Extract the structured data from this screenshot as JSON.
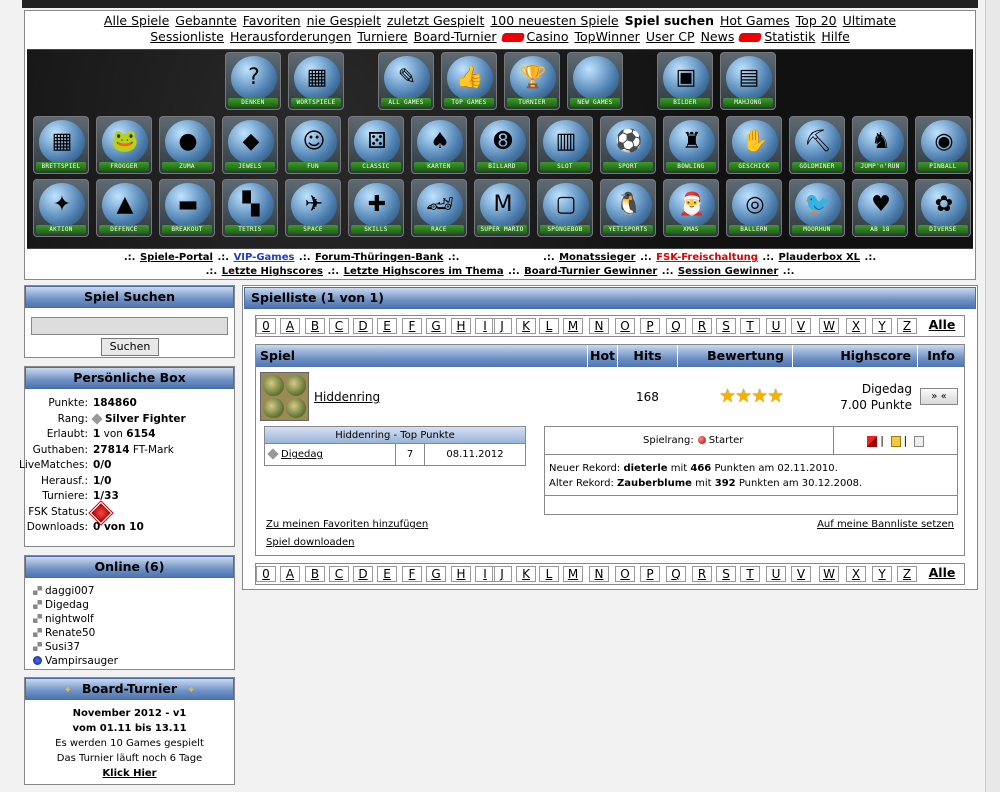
{
  "topnav": {
    "row1": [
      "Alle Spiele",
      "Gebannte",
      "Favoriten",
      "nie Gespielt",
      "zuletzt Gespielt",
      "100 neuesten Spiele",
      "Spiel suchen",
      "Hot Games",
      "Top 20",
      "Ultimate"
    ],
    "row2": [
      "Sessionliste",
      "Herausforderungen",
      "Turniere",
      "Board-Turnier",
      "Casino",
      "TopWinner",
      "User CP",
      "News",
      "Statistik",
      "Hilfe"
    ],
    "active": "Spiel suchen"
  },
  "games": {
    "row1": [
      "DENKEN",
      "WORTSPIELE",
      "ALL GAMES",
      "TOP GAMES",
      "TURNIER",
      "NEW GAMES",
      "BILDER",
      "MAHJONG"
    ],
    "row2": [
      "BRETTSPIEL",
      "FROGGER",
      "ZUMA",
      "JEWELS",
      "FUN",
      "CLASSIC",
      "KARTEN",
      "BILLARD",
      "SLOT",
      "SPORT",
      "BOWLING",
      "GESCHICK",
      "GOLDMINER",
      "JUMP'n'RUN",
      "PINBALL"
    ],
    "row3": [
      "AKTION",
      "DEFENCE",
      "BREAKOUT",
      "TETRIS",
      "SPACE",
      "SKILLS",
      "RACE",
      "SUPER MARIO",
      "SPONGEBOB",
      "YETISPORTS",
      "XMAS",
      "BALLERN",
      "MOORHUN",
      "AB 18",
      "DIVERSE"
    ]
  },
  "sublinks": {
    "spiele_portal": "Spiele-Portal",
    "vip": "VIP-Games",
    "forum": "Forum-Thüringen-Bank",
    "monatssieger": "Monatssieger",
    "fsk": "FSK-Freischaltung",
    "plauderbox": "Plauderbox XL",
    "letzte_hs": "Letzte Highscores",
    "letzte_hs_thema": "Letzte Highscores im Thema",
    "bt_gewinner": "Board-Turnier Gewinner",
    "session_gewinner": "Session Gewinner",
    "sep": ".:."
  },
  "search": {
    "title": "Spiel Suchen",
    "button": "Suchen",
    "value": ""
  },
  "profile": {
    "title": "Persönliche Box",
    "rows": [
      {
        "k": "Punkte:",
        "v": "184860"
      },
      {
        "k": "Rang:",
        "v": "Silver Fighter"
      },
      {
        "k": "Erlaubt:",
        "v": "1",
        "v2": "von",
        "v3": "6154"
      },
      {
        "k": "Guthaben:",
        "v": "27814",
        "v2": "FT-Mark"
      },
      {
        "k": "LiveMatches:",
        "v": "0/0"
      },
      {
        "k": "Herausf.:",
        "v": "1/0"
      },
      {
        "k": "Turniere:",
        "v": "1/33"
      },
      {
        "k": "FSK Status:",
        "v": ""
      },
      {
        "k": "Downloads:",
        "v": "0 von 10"
      }
    ]
  },
  "online": {
    "title": "Online (6)",
    "users": [
      "daggi007",
      "Digedag",
      "nightwolf",
      "Renate50",
      "Susi37",
      "Vampirsauger"
    ]
  },
  "board_turnier": {
    "title": "Board-Turnier",
    "line1": "November 2012 - v1",
    "line2": "vom 01.11 bis 13.11",
    "line3": "Es werden 10 Games gespielt",
    "line4": "Das Turnier läuft noch 6 Tage",
    "link": "Klick Hier"
  },
  "main": {
    "title": "Spielliste (1 von 1)",
    "letters": [
      "0",
      "A",
      "B",
      "C",
      "D",
      "E",
      "F",
      "G",
      "H",
      "I",
      "J",
      "K",
      "L",
      "M",
      "N",
      "O",
      "P",
      "Q",
      "R",
      "S",
      "T",
      "U",
      "V",
      "W",
      "X",
      "Y",
      "Z"
    ],
    "alle": "Alle",
    "columns": {
      "spiel": "Spiel",
      "hot": "Hot",
      "hits": "Hits",
      "bewertung": "Bewertung",
      "highscore": "Highscore",
      "info": "Info"
    },
    "game": {
      "name": "Hiddenring",
      "hits": "168",
      "rating": 4,
      "hs_name": "Digedag",
      "hs_points": "7.00 Punkte",
      "info_button": "» «"
    },
    "top_points": {
      "title": "Hiddenring - Top Punkte",
      "rows": [
        {
          "name": "Digedag",
          "score": "7",
          "date": "08.11.2012"
        }
      ]
    },
    "rank": {
      "label": "Spielrang:",
      "value": "Starter",
      "new_record_pre": "Neuer Rekord:",
      "new_record_name": "dieterle",
      "new_record_mid": "mit",
      "new_record_points": "466",
      "new_record_post": "Punkten am 02.11.2010.",
      "old_record_pre": "Alter Rekord:",
      "old_record_name": "Zauberblume",
      "old_record_mid": "mit",
      "old_record_points": "392",
      "old_record_post": "Punkten am 30.12.2008."
    },
    "fav_link": "Zu meinen Favoriten hinzufügen",
    "ban_link": "Auf meine Bannliste setzen",
    "download_link": "Spiel downloaden"
  },
  "colors": {
    "header_blue": "#6f91c4",
    "accent_red": "#e00000",
    "link_blue": "#1a3bd1",
    "star": "#f0b400",
    "icon_label_green": "#3e9a2a"
  }
}
